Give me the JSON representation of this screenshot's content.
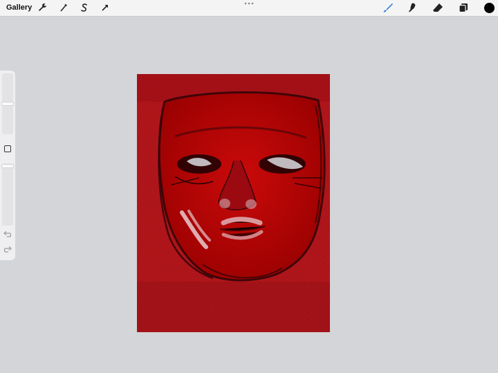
{
  "toolbar": {
    "gallery_label": "Gallery",
    "left_tools": [
      "wrench-icon",
      "magic-wand-icon",
      "selection-icon",
      "transform-arrow-icon"
    ],
    "right_tools": [
      "brush-icon",
      "smudge-icon",
      "eraser-icon",
      "layers-icon"
    ],
    "active_tool": "brush-icon",
    "accent_color": "#1f6fd8",
    "current_color": "#000000"
  },
  "sidebar": {
    "controls": [
      "brush-size-slider",
      "modify-button",
      "opacity-slider",
      "undo-icon",
      "redo-icon"
    ]
  },
  "canvas": {
    "background_color": "#b10000",
    "artwork": "red-face-painting"
  }
}
